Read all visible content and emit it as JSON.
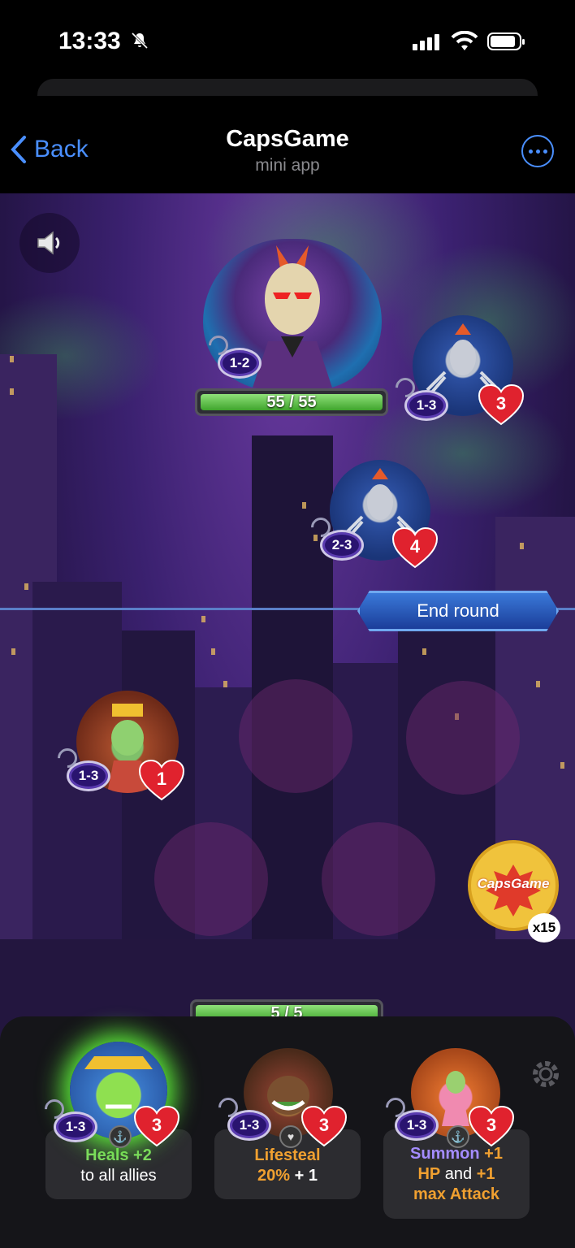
{
  "status": {
    "time": "13:33"
  },
  "nav": {
    "back_label": "Back",
    "title": "CapsGame",
    "subtitle": "mini app"
  },
  "enemies": {
    "boss": {
      "name_icon": "boss-portrait",
      "level": "1-2",
      "hp": "55 / 55",
      "hp_fraction": 1.0
    },
    "spider_top": {
      "level": "1-3",
      "health": "3"
    },
    "spider_mid": {
      "level": "2-3",
      "health": "4"
    }
  },
  "end_round_label": "End round",
  "player": {
    "ally": {
      "level": "1-3",
      "health": "1"
    },
    "hp": "5 / 5",
    "hp_fraction": 1.0,
    "caps_count": "x15",
    "cap_logo": "CapsGame"
  },
  "hand": [
    {
      "level": "1-3",
      "health": "3",
      "ability_highlight": "Heals +2",
      "ability_rest": "to all allies"
    },
    {
      "level": "1-3",
      "health": "3",
      "ability_line1": "Lifesteal",
      "ability_line2a": "20%",
      "ability_line2b": " + 1"
    },
    {
      "level": "1-3",
      "health": "3",
      "ability_line1a": "Summon",
      "ability_line1b": " +1",
      "ability_line2a": "HP",
      "ability_line2b": " and ",
      "ability_line2c": "+1",
      "ability_line3": "max Attack"
    }
  ],
  "colors": {
    "accent_blue": "#4a8fff",
    "hp_green": "#3fa52c",
    "heart_red": "#e0222e",
    "heal_green": "#7fd860",
    "lifesteal_orange": "#f0a030",
    "summon_purple": "#a48cff"
  }
}
